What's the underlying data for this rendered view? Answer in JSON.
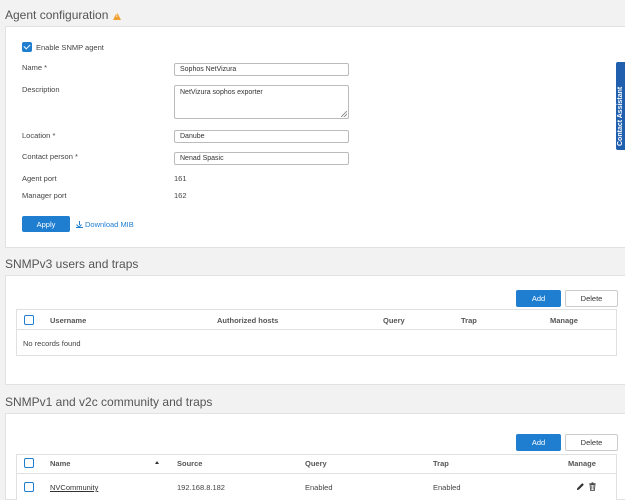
{
  "agent_config": {
    "title": "Agent configuration",
    "enable_label": "Enable SNMP agent",
    "name_label": "Name *",
    "name_value": "Sophos NetVizura",
    "description_label": "Description",
    "description_value": "NetVizura sophos exporter",
    "location_label": "Location *",
    "location_value": "Danube",
    "contact_label": "Contact person *",
    "contact_value": "Nenad Spasic",
    "agent_port_label": "Agent port",
    "agent_port_value": "161",
    "manager_port_label": "Manager port",
    "manager_port_value": "162",
    "apply_label": "Apply",
    "download_label": "Download MIB"
  },
  "snmpv3": {
    "title": "SNMPv3 users and traps",
    "add_label": "Add",
    "delete_label": "Delete",
    "columns": [
      "Username",
      "Authorized hosts",
      "Query",
      "Trap",
      "Manage"
    ],
    "empty_text": "No records found"
  },
  "snmpv1": {
    "title": "SNMPv1 and v2c community and traps",
    "add_label": "Add",
    "delete_label": "Delete",
    "columns": [
      "Name",
      "Source",
      "Query",
      "Trap",
      "Manage"
    ],
    "rows": [
      {
        "name": "NVCommunity",
        "source": "192.168.8.182",
        "query": "Enabled",
        "trap": "Enabled"
      }
    ]
  },
  "side_tab": {
    "label": "Contact Assistant"
  },
  "colors": {
    "accent": "#1f7ed0",
    "warning": "#f0a030",
    "side_tab": "#1f5fae"
  }
}
